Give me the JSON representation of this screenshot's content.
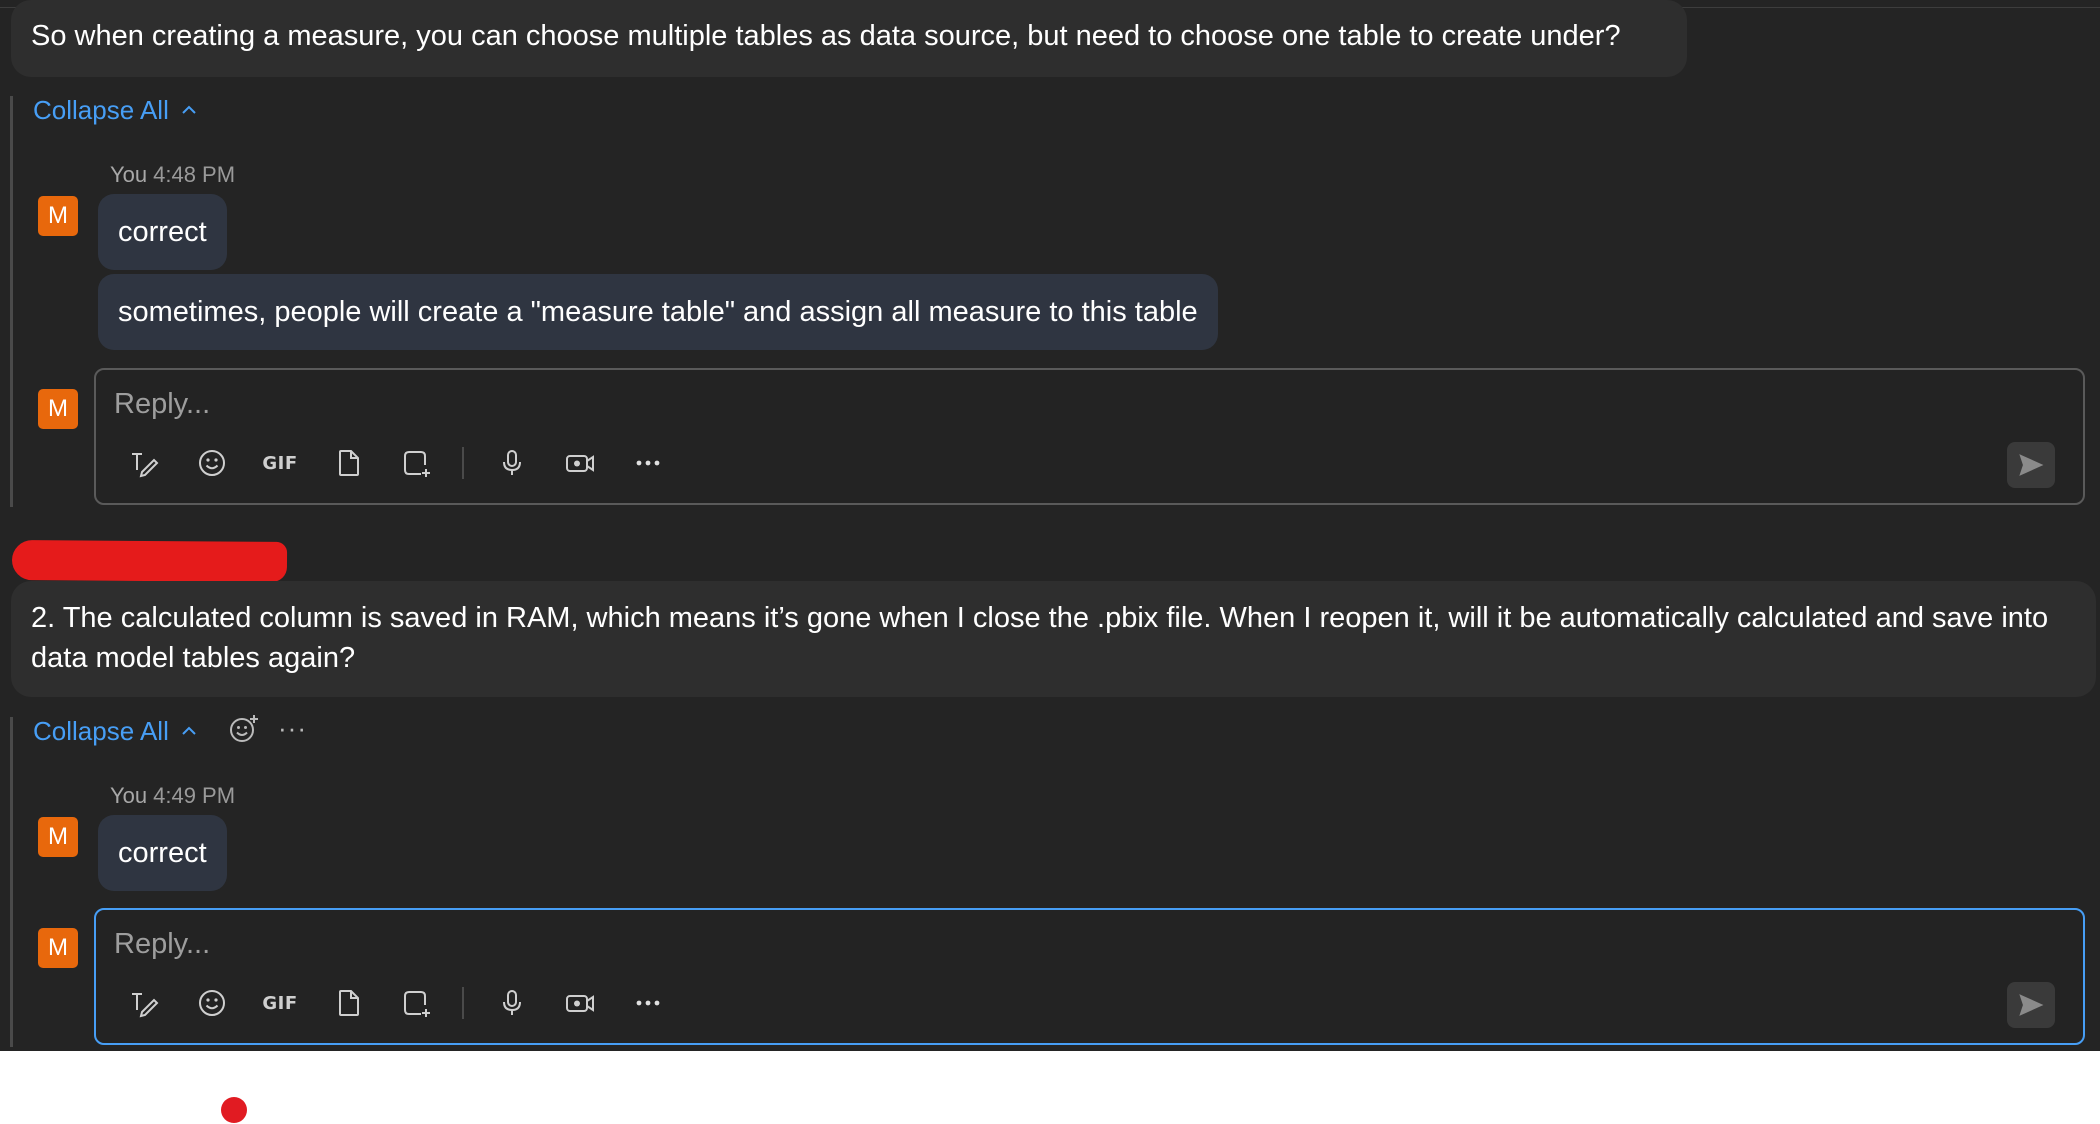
{
  "colors": {
    "background": "#242424",
    "accent": "#479ef5",
    "avatar": "#e8680c",
    "bubble": "#2f3541",
    "post": "#2e2e2e",
    "redaction": "#e51b1b"
  },
  "threads": [
    {
      "post_text": "So when creating a measure, you can choose multiple tables as data source, but need to choose one table to create under?",
      "collapse_label": "Collapse All",
      "reply": {
        "author_initial": "M",
        "author": "You",
        "time": "4:48 PM",
        "messages": [
          "correct",
          "sometimes, people will create a \"measure table\" and assign all measure to this table"
        ]
      },
      "composer": {
        "avatar_initial": "M",
        "placeholder": "Reply..."
      }
    },
    {
      "post_text": "2. The calculated column is saved in RAM, which means it’s gone when I close the .pbix file. When I reopen it, will it be automatically calculated and save into data model tables again?",
      "collapse_label": "Collapse All",
      "more_label": "···",
      "reply": {
        "author_initial": "M",
        "author": "You",
        "time": "4:49 PM",
        "messages": [
          "correct"
        ]
      },
      "composer": {
        "avatar_initial": "M",
        "placeholder": "Reply..."
      }
    }
  ],
  "toolbar": {
    "gif_label": "GIF",
    "more_label": "•••",
    "icons": [
      "format-pen-icon",
      "emoji-icon",
      "gif-icon",
      "attach-file-icon",
      "loop-component-icon",
      "microphone-icon",
      "video-clip-icon",
      "more-options-icon",
      "send-icon"
    ]
  }
}
